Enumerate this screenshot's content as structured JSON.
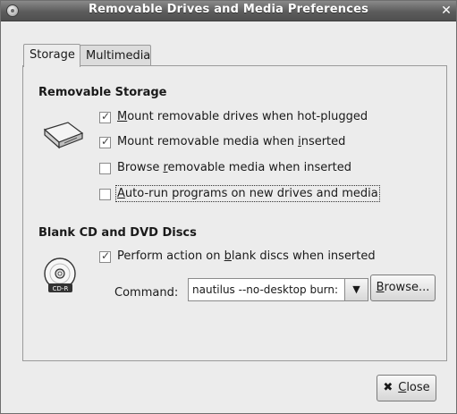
{
  "window": {
    "title": "Removable Drives and Media Preferences",
    "close_glyph": "✕"
  },
  "tabs": [
    {
      "label": "Storage",
      "active": true
    },
    {
      "label": "Multimedia",
      "active": false
    }
  ],
  "removable_storage": {
    "heading": "Removable Storage",
    "options": [
      {
        "before": "",
        "mnemonic": "M",
        "after": "ount removable drives when hot-plugged",
        "checked": true
      },
      {
        "before": "Mount removable media when ",
        "mnemonic": "i",
        "after": "nserted",
        "checked": true
      },
      {
        "before": "Browse ",
        "mnemonic": "r",
        "after": "emovable media when inserted",
        "checked": false
      },
      {
        "before": "",
        "mnemonic": "A",
        "after": "uto-run programs on new drives and media",
        "checked": false
      }
    ]
  },
  "blank_discs": {
    "heading": "Blank CD and DVD Discs",
    "option": {
      "before": "Perform action on ",
      "mnemonic": "b",
      "after": "lank discs when inserted",
      "checked": true
    },
    "command_label": "Command:",
    "command_value": "nautilus --no-desktop burn:",
    "browse": {
      "mnemonic": "B",
      "after": "rowse..."
    },
    "cd_label": "CD-R"
  },
  "footer": {
    "close": {
      "mnemonic": "C",
      "after": "lose"
    }
  },
  "icons": {
    "title": "disc-icon",
    "drive": "removable-drive-icon",
    "cd": "cd-r-icon",
    "close": "close-icon",
    "dropdown": "chevron-down-icon"
  }
}
